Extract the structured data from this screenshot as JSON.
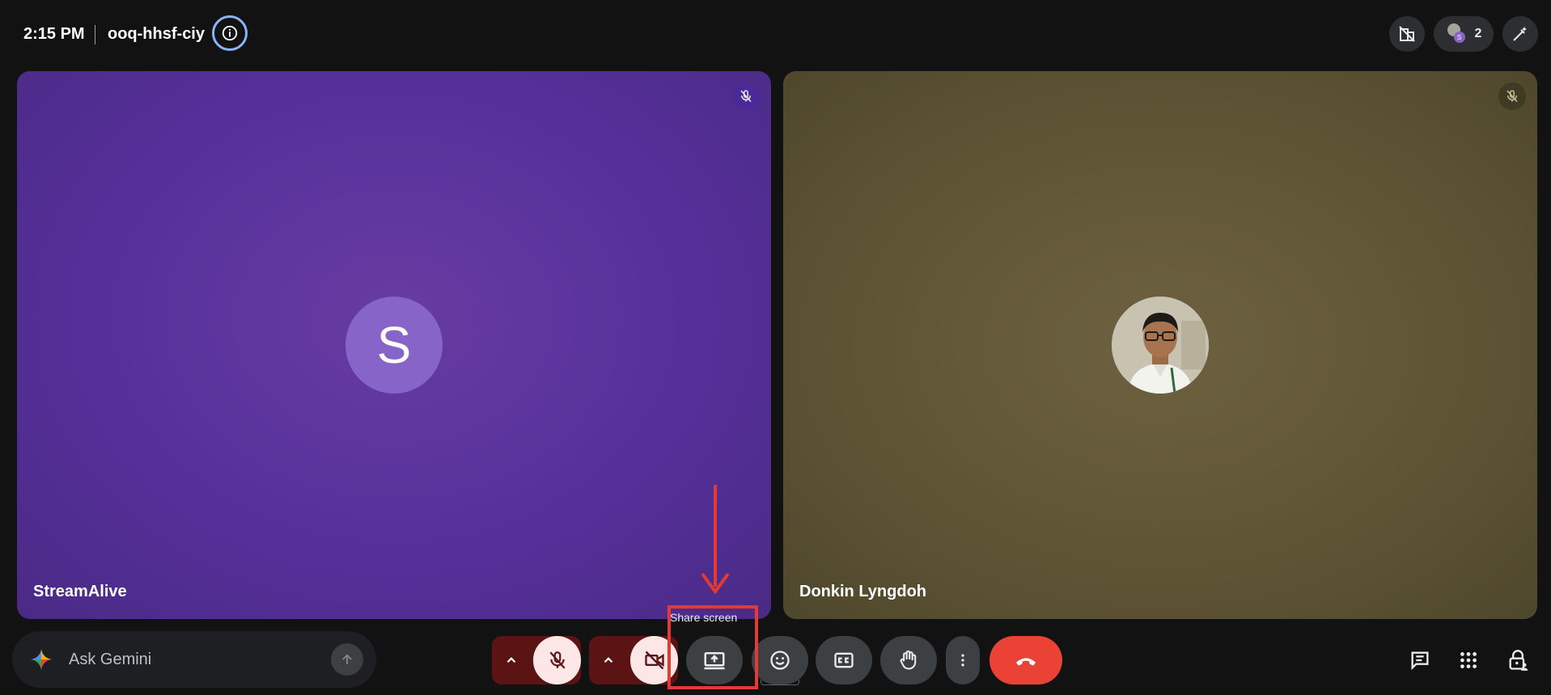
{
  "header": {
    "time": "2:15 PM",
    "meeting_code": "ooq-hhsf-ciy",
    "participant_count": "2",
    "participant_avatar_letter": "S"
  },
  "tiles": [
    {
      "name": "StreamAlive",
      "avatar_letter": "S",
      "muted": true
    },
    {
      "name": "Donkin Lyngdoh",
      "muted": true
    }
  ],
  "gemini": {
    "placeholder": "Ask Gemini"
  },
  "tooltip": {
    "text": "Share screen"
  },
  "colors": {
    "accent_info": "#8ab4f8",
    "end_call": "#ea4335",
    "annotation": "#e53935"
  }
}
